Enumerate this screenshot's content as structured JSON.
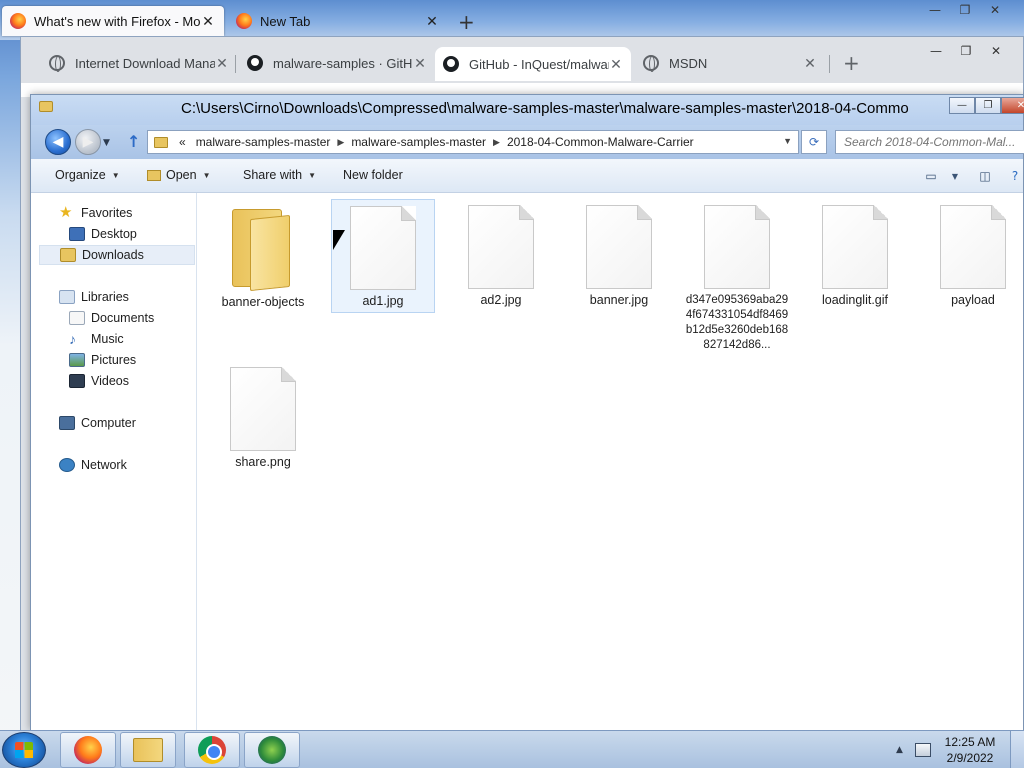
{
  "firefox": {
    "tabs": [
      {
        "title": "What's new with Firefox - More"
      },
      {
        "title": "New Tab"
      }
    ]
  },
  "chrome": {
    "tabs": [
      {
        "title": "Internet Download Mana",
        "icon": "globe-icon"
      },
      {
        "title": "malware-samples · GitHub",
        "icon": "github-icon"
      },
      {
        "title": "GitHub - InQuest/malwar",
        "icon": "github-icon"
      },
      {
        "title": "MSDN",
        "icon": "globe-icon"
      }
    ]
  },
  "explorer": {
    "title": "C:\\Users\\Cirno\\Downloads\\Compressed\\malware-samples-master\\malware-samples-master\\2018-04-Commo",
    "breadcrumb": [
      "«",
      "malware-samples-master",
      "malware-samples-master",
      "2018-04-Common-Malware-Carrier"
    ],
    "search_placeholder": "Search 2018-04-Common-Mal...",
    "toolbar": {
      "organize": "Organize",
      "open": "Open",
      "share_with": "Share with",
      "new_folder": "New folder"
    },
    "nav": {
      "favorites": "Favorites",
      "desktop": "Desktop",
      "downloads": "Downloads",
      "libraries": "Libraries",
      "documents": "Documents",
      "music": "Music",
      "pictures": "Pictures",
      "videos": "Videos",
      "computer": "Computer",
      "network": "Network"
    },
    "files": [
      {
        "name": "banner-objects",
        "type": "folder"
      },
      {
        "name": "ad1.jpg",
        "type": "file",
        "selected": true
      },
      {
        "name": "ad2.jpg",
        "type": "file"
      },
      {
        "name": "banner.jpg",
        "type": "file"
      },
      {
        "name": "d347e095369aba294f674331054df8469b12d5e3260deb168827142d86...",
        "type": "file"
      },
      {
        "name": "loadinglit.gif",
        "type": "file"
      },
      {
        "name": "payload",
        "type": "file"
      },
      {
        "name": "share.png",
        "type": "file"
      }
    ]
  },
  "taskbar": {
    "time": "12:25 AM",
    "date": "2/9/2022"
  }
}
